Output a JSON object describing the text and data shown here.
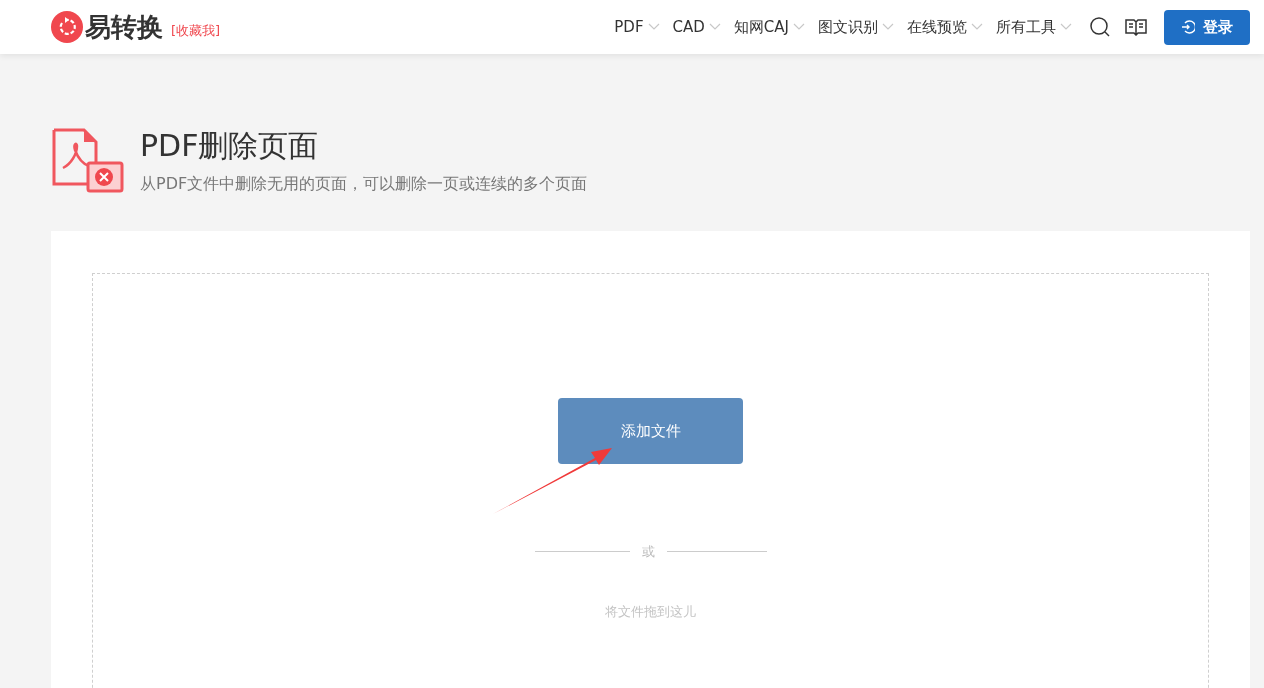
{
  "header": {
    "logo": "易转换",
    "bookmark": "[收藏我]",
    "nav": [
      {
        "label": "PDF"
      },
      {
        "label": "CAD"
      },
      {
        "label": "知网CAJ"
      },
      {
        "label": "图文识别"
      },
      {
        "label": "在线预览"
      },
      {
        "label": "所有工具"
      }
    ],
    "login": "登录"
  },
  "tool": {
    "title": "PDF删除页面",
    "subtitle": "从PDF文件中删除无用的页面，可以删除一页或连续的多个页面"
  },
  "upload": {
    "button": "添加文件",
    "divider": "或",
    "drop_hint": "将文件拖到这儿"
  }
}
